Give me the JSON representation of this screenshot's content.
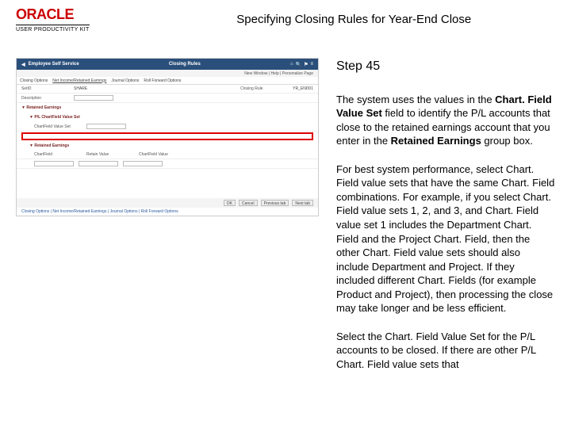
{
  "header": {
    "logo_text": "ORACLE",
    "logo_sub": "USER PRODUCTIVITY KIT",
    "title": "Specifying Closing Rules for Year-End Close"
  },
  "thumb": {
    "breadcrumb_back": "Employee Self Service",
    "app_title": "Closing Rules",
    "top_right_link": "New Window | Help | Personalize Page",
    "tab1": "Closing Options",
    "tab2": "Net Income/Retained Earnings",
    "tab3": "Journal Options",
    "tab4": "Roll Forward Options",
    "row1_label": "SetID",
    "row1_val": "SHARE",
    "row2_label": "Closing Rule",
    "row2_val": "YR_END01",
    "row3_label": "Description",
    "re_header": "Retained Earnings",
    "pl_header": "P/L ChartField Value Set",
    "cf_label": "ChartField Value Set",
    "re_section": "Retained Earnings",
    "rf_label": "Retain Value",
    "cv_label": "ChartField Value",
    "crumb_bottom": "Closing Options | Net Income/Retained Earnings | Journal Options | Roll Forward Options",
    "btn_ok": "OK",
    "btn_cancel": "Cancel",
    "btn_prev": "Previous tab",
    "btn_next": "Next tab"
  },
  "right": {
    "step": "Step 45",
    "p1_a": "The system uses the values in the ",
    "p1_b": "Chart. Field Value Set",
    "p1_c": " field to identify the P/L accounts that close to the retained earnings account that you enter in the ",
    "p1_d": "Retained Earnings",
    "p1_e": " group box.",
    "p2": "For best system performance, select Chart. Field value sets that have the same Chart. Field combinations. For example, if you select Chart. Field value sets 1, 2, and 3, and Chart. Field value set 1 includes the Department Chart. Field and the Project Chart. Field, then the other Chart. Field value sets should also include Department and Project. If they included different Chart. Fields (for example Product and Project), then processing the close may take longer and be less efficient.",
    "p3": "Select the Chart. Field Value Set for the P/L accounts to be closed. If there are other P/L Chart. Field value sets that"
  }
}
